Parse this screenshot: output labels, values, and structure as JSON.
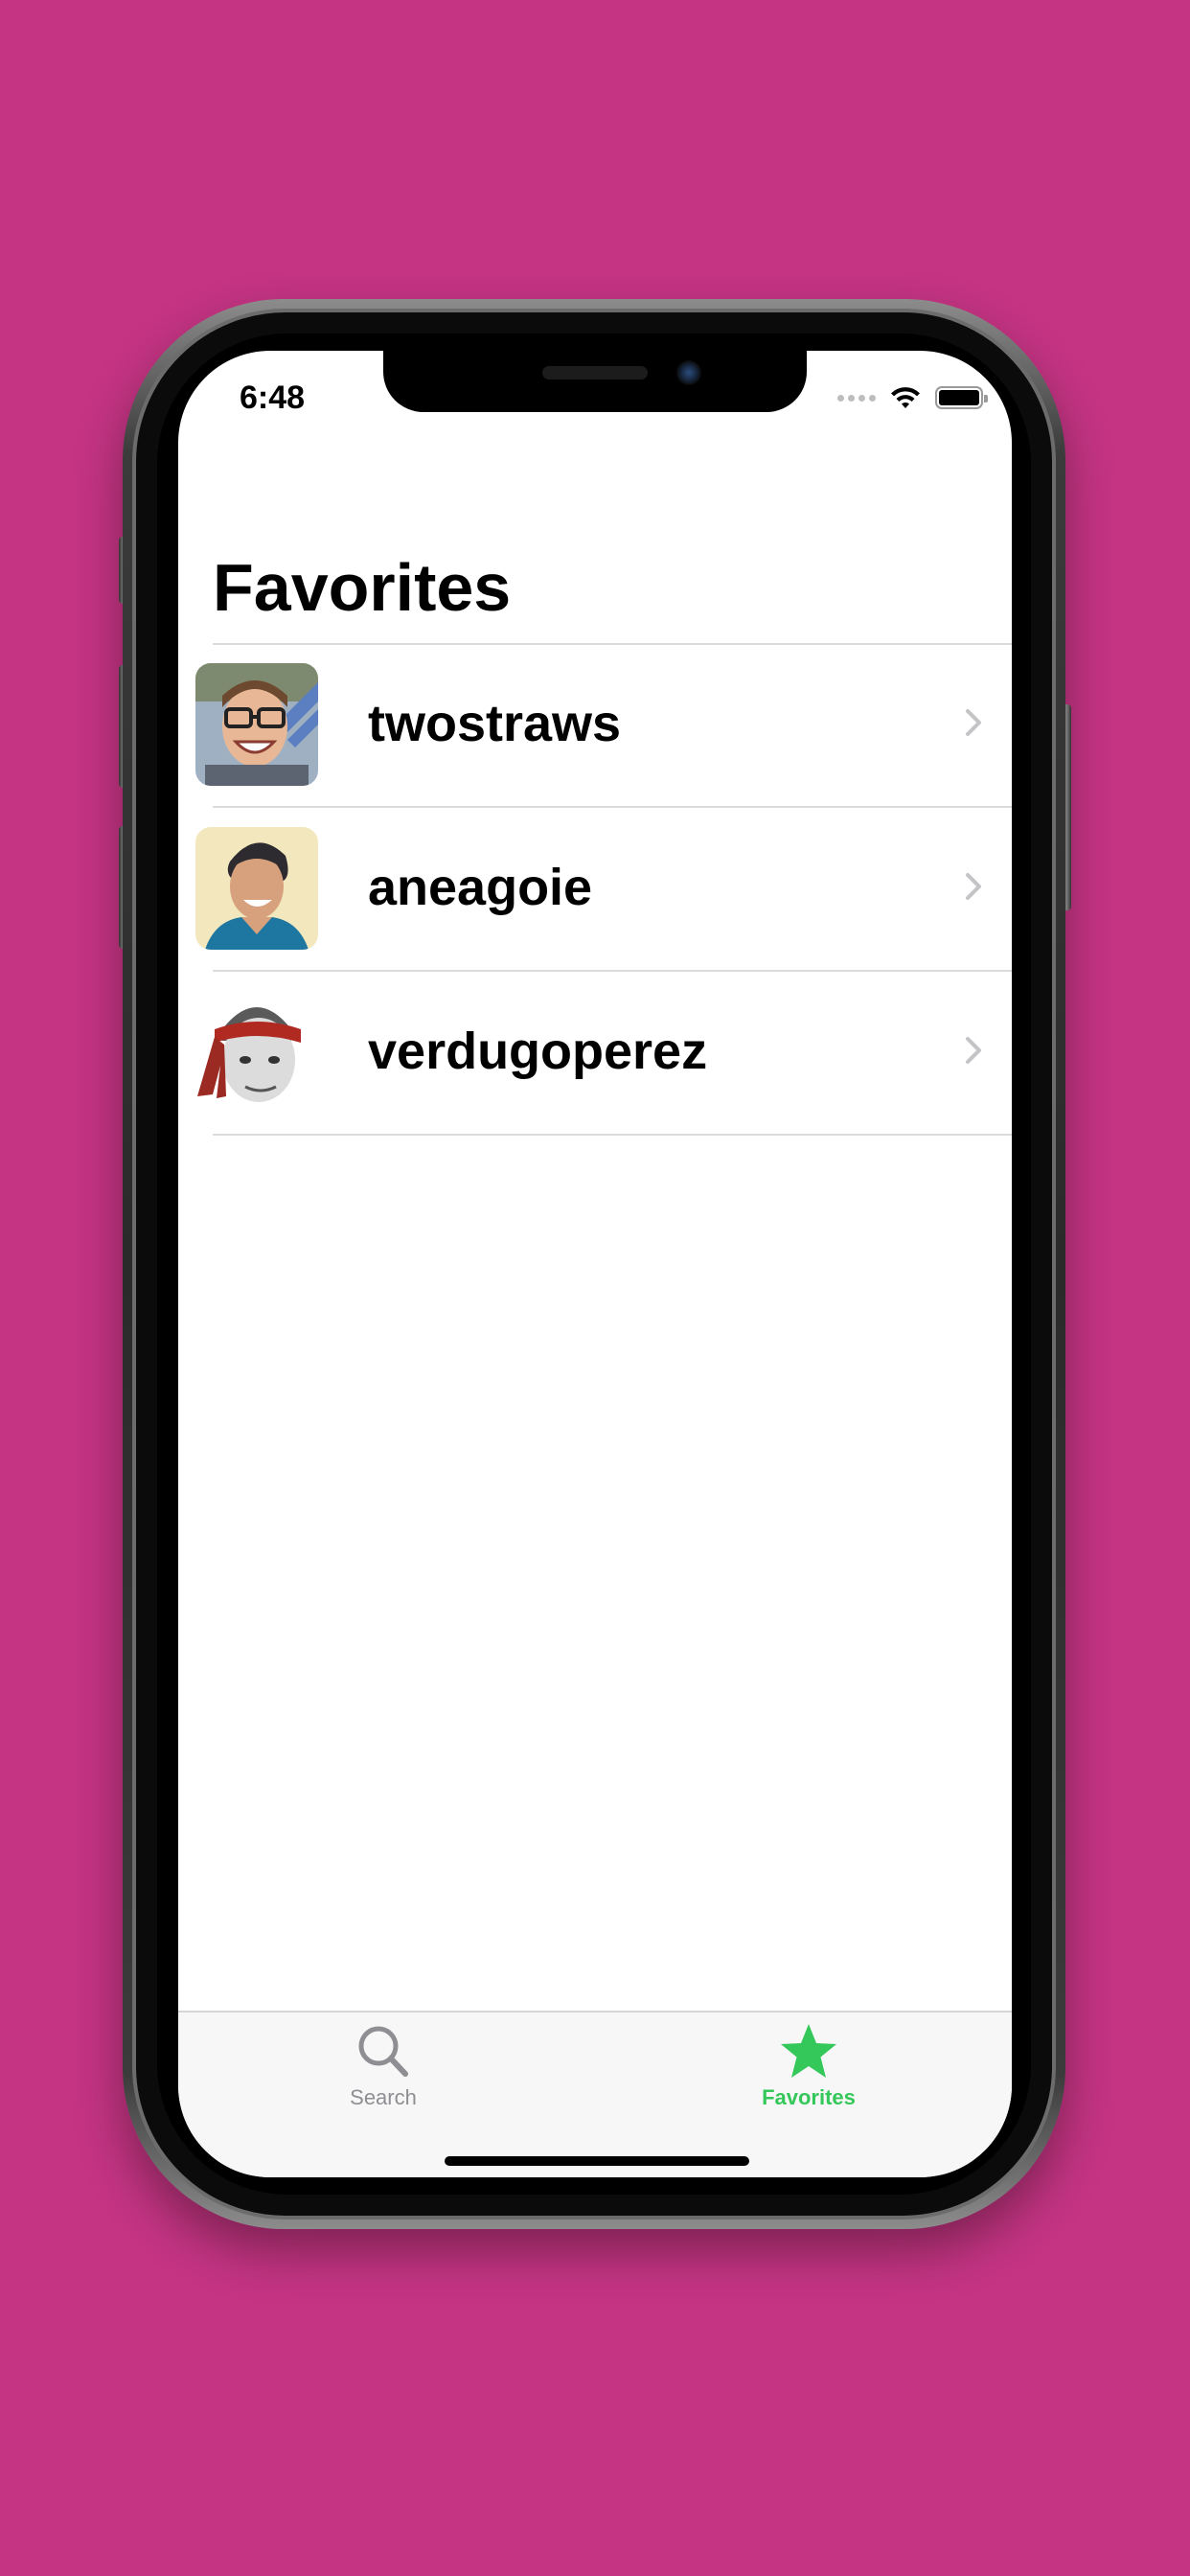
{
  "status_bar": {
    "time": "6:48"
  },
  "nav": {
    "title": "Favorites"
  },
  "favorites": [
    {
      "username": "twostraws",
      "avatar_bg": "#a9b6c6"
    },
    {
      "username": "aneagoie",
      "avatar_bg": "#f3e7bd"
    },
    {
      "username": "verdugoperez",
      "avatar_bg": "#ffffff"
    }
  ],
  "tab_bar": {
    "tabs": [
      {
        "label": "Search",
        "icon": "magnifying-glass-icon",
        "selected": false
      },
      {
        "label": "Favorites",
        "icon": "star-icon",
        "selected": true
      }
    ],
    "accent_color": "#34c759",
    "inactive_color": "#8e8e93"
  },
  "background_color": "#c43483"
}
